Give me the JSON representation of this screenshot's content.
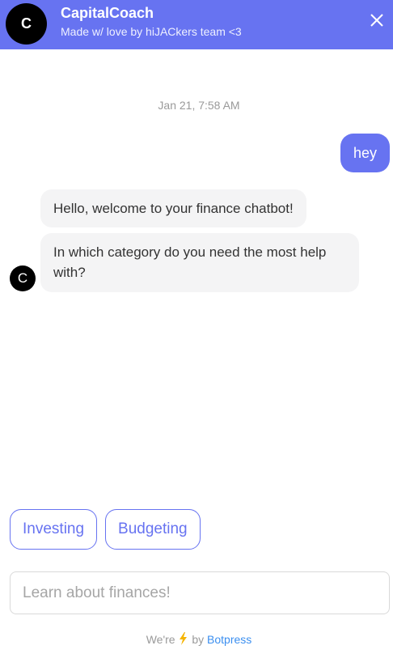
{
  "header": {
    "avatar_letter": "C",
    "title": "CapitalCoach",
    "subtitle": "Made w/ love by hiJACkers team <3",
    "close_icon": "close-icon"
  },
  "conversation": {
    "timestamp": "Jan 21, 7:58 AM",
    "user_message": "hey",
    "bot_messages": [
      "Hello, welcome to your finance chatbot!",
      "In which category do you need the most help with?"
    ],
    "bot_avatar_letter": "C"
  },
  "quick_replies": [
    "Investing",
    "Budgeting"
  ],
  "composer": {
    "placeholder": "Learn about finances!"
  },
  "footer": {
    "prefix": "We're",
    "by": "by",
    "brand": "Botpress"
  },
  "colors": {
    "accent": "#6773f1",
    "bubble_bot": "#f4f4f5",
    "link": "#3b8ff0",
    "bolt": "#f5b400"
  }
}
